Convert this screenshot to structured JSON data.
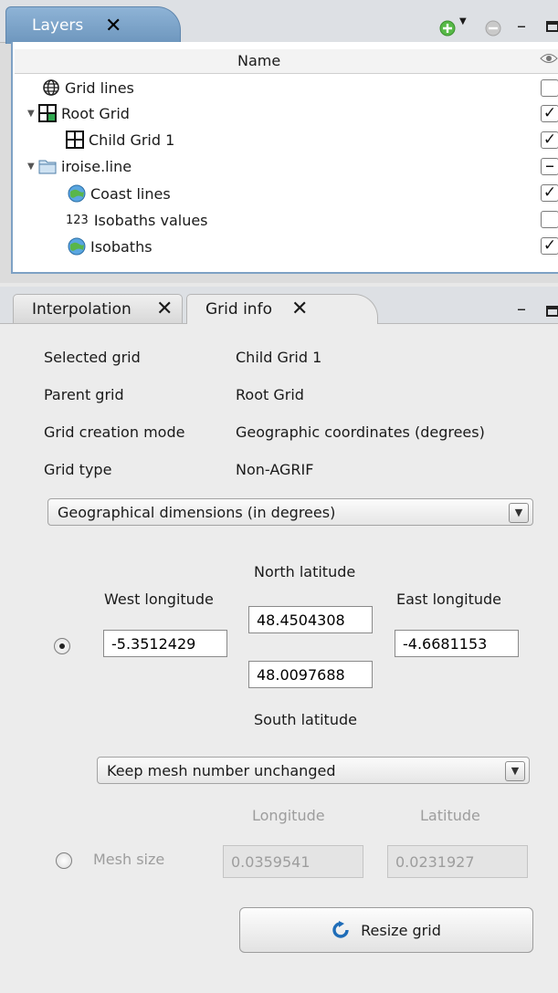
{
  "layers_view": {
    "tab_label": "Layers",
    "column_header": "Name",
    "rows": [
      {
        "label": "Grid lines",
        "visible": false
      },
      {
        "label": "Root Grid",
        "visible": true
      },
      {
        "label": "Child Grid 1",
        "visible": true
      },
      {
        "label": "iroise.line",
        "visible": "partial"
      },
      {
        "label": "Coast lines",
        "visible": true
      },
      {
        "label": "Isobaths values",
        "visible": false,
        "icon_text": "123"
      },
      {
        "label": "Isobaths",
        "visible": true
      }
    ]
  },
  "tabs": {
    "interpolation": "Interpolation",
    "grid_info": "Grid info"
  },
  "grid_info": {
    "selected_grid_label": "Selected grid",
    "selected_grid_value": "Child Grid 1",
    "parent_grid_label": "Parent grid",
    "parent_grid_value": "Root Grid",
    "creation_mode_label": "Grid creation mode",
    "creation_mode_value": "Geographic coordinates (degrees)",
    "grid_type_label": "Grid type",
    "grid_type_value": "Non-AGRIF",
    "dimensions_select": "Geographical dimensions (in degrees)",
    "north_label": "North latitude",
    "north_value": "48.4504308",
    "west_label": "West longitude",
    "west_value": "-5.3512429",
    "east_label": "East longitude",
    "east_value": "-4.6681153",
    "south_value": "48.0097688",
    "south_label": "South latitude",
    "mesh_select": "Keep mesh number unchanged",
    "longitude_header": "Longitude",
    "latitude_header": "Latitude",
    "mesh_size_label": "Mesh size",
    "mesh_lon_value": "0.0359541",
    "mesh_lat_value": "0.0231927",
    "resize_button": "Resize grid"
  },
  "colors": {
    "active_tab": "#7aa2c8",
    "selection_border": "#7ea1c4",
    "button_icon": "#1f6db8"
  }
}
